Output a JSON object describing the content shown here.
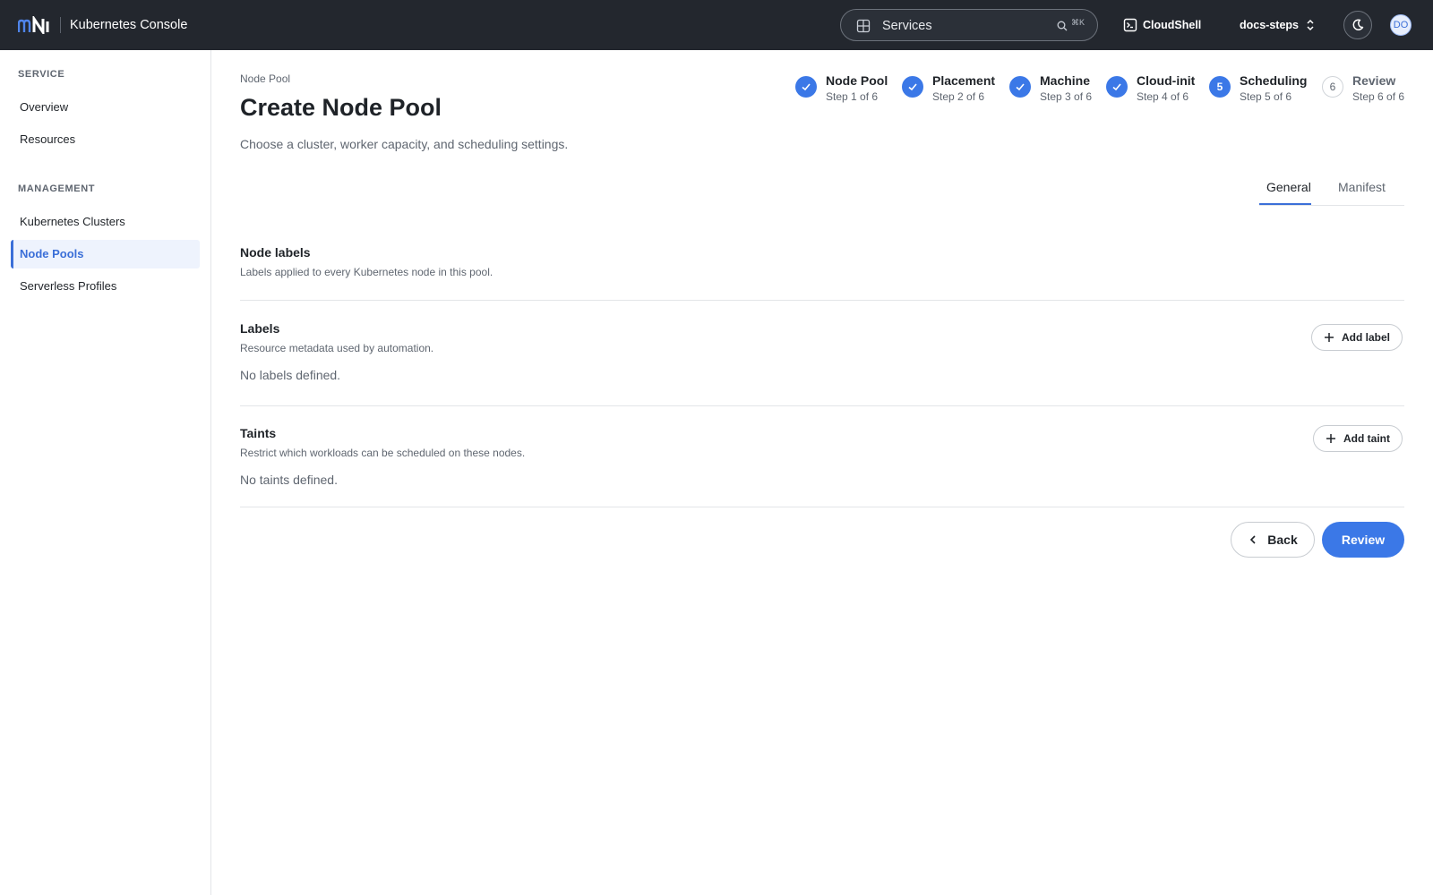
{
  "header": {
    "app_title": "Kubernetes Console",
    "search": {
      "value": "Services",
      "shortcut": "⌘K"
    },
    "cloudshell_label": "CloudShell",
    "project_name": "docs-steps",
    "avatar_initials": "DO"
  },
  "sidebar": {
    "sections": [
      {
        "title": "SERVICE",
        "items": [
          "Overview",
          "Resources"
        ]
      },
      {
        "title": "MANAGEMENT",
        "items": [
          "Kubernetes Clusters",
          "Node Pools",
          "Serverless Profiles"
        ]
      }
    ],
    "active_item": "Node Pools"
  },
  "page": {
    "breadcrumb": "Node Pool",
    "title": "Create Node Pool",
    "subtitle": "Choose a cluster, worker capacity, and scheduling settings."
  },
  "stepper": {
    "steps": [
      {
        "name": "Node Pool",
        "sub": "Step 1 of 6",
        "state": "done"
      },
      {
        "name": "Placement",
        "sub": "Step 2 of 6",
        "state": "done"
      },
      {
        "name": "Machine",
        "sub": "Step 3 of 6",
        "state": "done"
      },
      {
        "name": "Cloud-init",
        "sub": "Step 4 of 6",
        "state": "done"
      },
      {
        "name": "Scheduling",
        "sub": "Step 5 of 6",
        "state": "current",
        "number": "5"
      },
      {
        "name": "Review",
        "sub": "Step 6 of 6",
        "state": "pending",
        "number": "6"
      }
    ]
  },
  "tabs": {
    "general": "General",
    "manifest": "Manifest",
    "active": "General"
  },
  "sections": {
    "node_labels": {
      "title": "Node labels",
      "description": "Labels applied to every Kubernetes node in this pool."
    },
    "labels": {
      "title": "Labels",
      "description": "Resource metadata used by automation.",
      "empty": "No labels defined.",
      "add_button": "Add label"
    },
    "taints": {
      "title": "Taints",
      "description": "Restrict which workloads can be scheduled on these nodes.",
      "empty": "No taints defined.",
      "add_button": "Add taint"
    }
  },
  "footer": {
    "back_label": "Back",
    "review_label": "Review"
  },
  "colors": {
    "accent": "#3b78e7",
    "topbar": "#23272e",
    "active_nav_bg": "#eef3fd"
  }
}
